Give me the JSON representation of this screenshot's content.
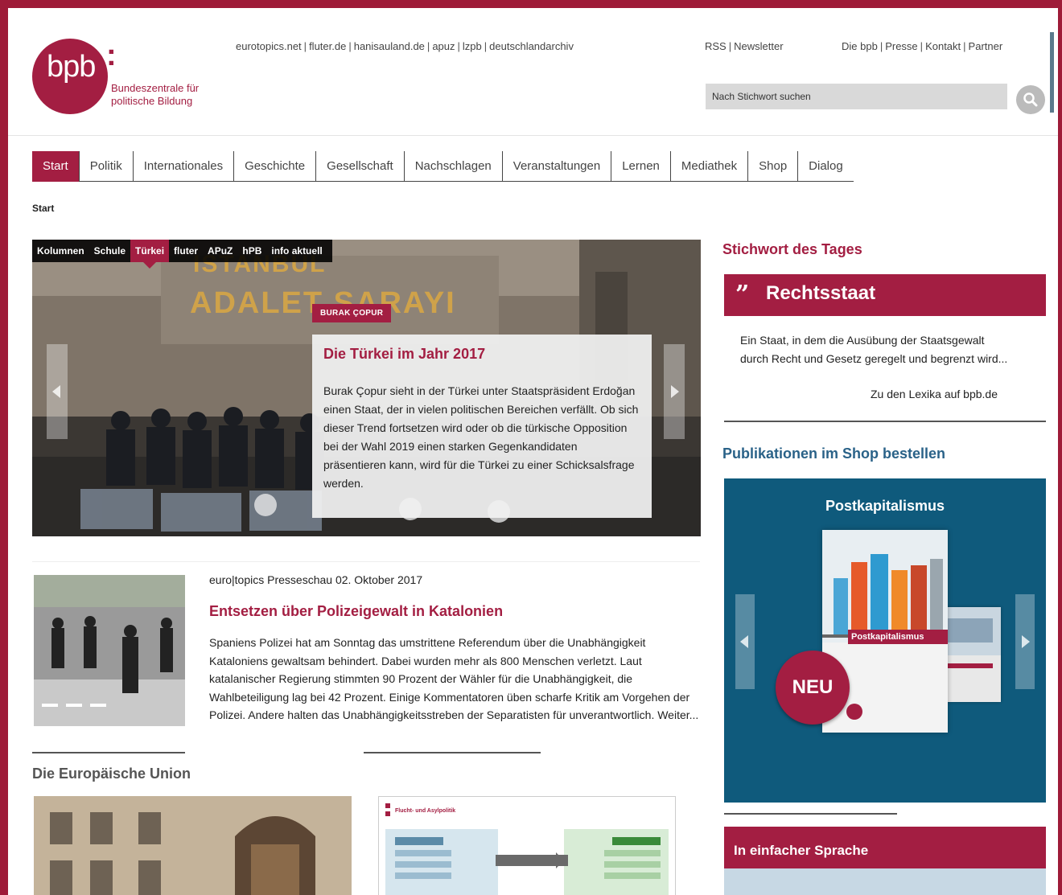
{
  "header": {
    "logo_text": "bpb",
    "logo_colon": ":",
    "org_name_line1": "Bundeszentrale für",
    "org_name_line2": "politische Bildung",
    "top_links": [
      "eurotopics.net",
      "fluter.de",
      "hanisauland.de",
      "apuz",
      "lzpb",
      "deutschlandarchiv"
    ],
    "rss_links": [
      "RSS",
      "Newsletter"
    ],
    "right_links": [
      "Die bpb",
      "Presse",
      "Kontakt",
      "Partner"
    ],
    "search_placeholder": "Nach Stichwort suchen"
  },
  "nav": {
    "tabs": [
      "Start",
      "Politik",
      "Internationales",
      "Geschichte",
      "Gesellschaft",
      "Nachschlagen",
      "Veranstaltungen",
      "Lernen",
      "Mediathek",
      "Shop",
      "Dialog"
    ],
    "active": "Start"
  },
  "breadcrumb": "Start",
  "hero": {
    "tabs": [
      "Kolumnen",
      "Schule",
      "Türkei",
      "fluter",
      "APuZ",
      "hPB",
      "info aktuell"
    ],
    "active_tab": "Türkei",
    "author": "BURAK ÇOPUR",
    "title": "Die Türkei im Jahr 2017",
    "text": "Burak Çopur sieht in der Türkei unter Staatspräsident Erdoğan einen Staat, der in vielen politischen Bereichen verfällt. Ob sich dieser Trend fortsetzen wird oder ob die türkische Opposition bei der Wahl 2019 einen starken Gegenkandidaten präsentieren kann, wird für die Türkei zu einer Schicksalsfrage werden.",
    "building_sign_1": "ISTANBUL",
    "building_sign_2": "ADALET SARAYI"
  },
  "article": {
    "meta": "euro|topics Presseschau 02. Oktober 2017",
    "title": "Entsetzen über Polizeigewalt in Katalonien",
    "text": "Spaniens Polizei hat am Sonntag das umstrittene Referendum über die Unabhängigkeit Kataloniens gewaltsam behindert. Dabei wurden mehr als 800 Menschen verletzt. Laut katalanischer Regierung stimmten 90 Prozent der Wähler für die Unabhängigkeit, die Wahlbeteiligung lag bei 42 Prozent. Einige Kommentatoren üben scharfe Kritik am Vorgehen der Polizei. Andere halten das Unabhängigkeitsstreben der Separatisten für unverantwortlich. Weiter..."
  },
  "eu_section": {
    "heading": "Die Europäische Union",
    "diagram_title": "Flucht- und Asylpolitik"
  },
  "sidebar": {
    "keyword_heading": "Stichwort des Tages",
    "keyword_quote": "”",
    "keyword_title": "Rechtsstaat",
    "keyword_text": "Ein Staat, in dem die Ausübung der Staatsgewalt durch Recht und Gesetz geregelt und begrenzt wird...",
    "keyword_link": "Zu den Lexika auf bpb.de",
    "shop_heading": "Publikationen im Shop bestellen",
    "shop_title": "Postkapitalismus",
    "book_label": "Postkapitalismus",
    "new_badge": "NEU",
    "easy_heading": "In einfacher Sprache"
  },
  "colors": {
    "brand": "#a31e42",
    "shop_bg": "#0f5a7c",
    "shop_heading": "#2a6288"
  },
  "icons": [
    "search-icon",
    "chevron-left-icon",
    "chevron-right-icon",
    "quote-icon"
  ]
}
